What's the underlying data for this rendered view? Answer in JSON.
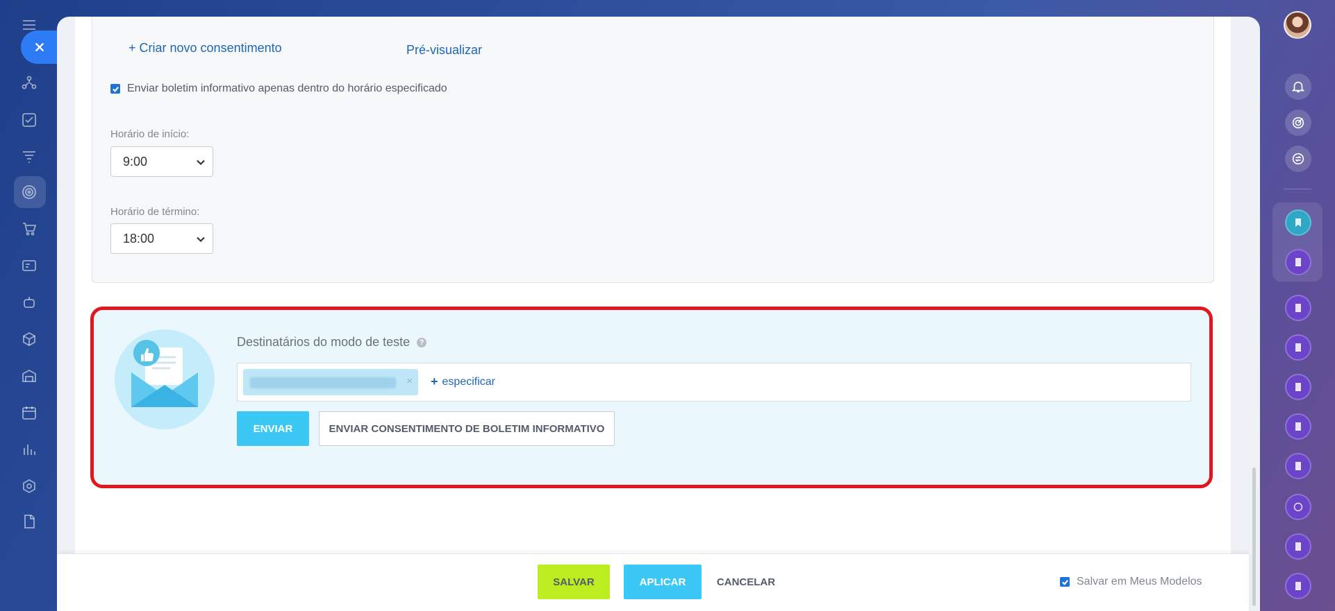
{
  "settings": {
    "create_consent_link": "+ Criar novo consentimento",
    "preview_link": "Pré-visualizar",
    "time_restriction_checkbox_label": "Enviar boletim informativo apenas dentro do horário especificado",
    "time_restriction_checked": true,
    "start_time_label": "Horário de início:",
    "start_time_value": "9:00",
    "end_time_label": "Horário de término:",
    "end_time_value": "18:00"
  },
  "test_mode": {
    "title": "Destinatários do modo de teste",
    "help_icon": "?",
    "recipient_tag_remove": "×",
    "specify_link_plus": "+",
    "specify_link": "especificar",
    "send_button": "ENVIAR",
    "send_consent_button": "ENVIAR CONSENTIMENTO DE BOLETIM INFORMATIVO"
  },
  "footer": {
    "save_button": "SALVAR",
    "apply_button": "APLICAR",
    "cancel_button": "CANCELAR",
    "save_template_label": "Salvar em Meus Modelos",
    "save_template_checked": true
  },
  "left_sidebar": {
    "icons": [
      "menu-icon",
      "close-icon",
      "network-icon",
      "task-check-icon",
      "funnel-icon",
      "target-icon",
      "cart-icon",
      "id-card-icon",
      "robot-icon",
      "cube-icon",
      "warehouse-icon",
      "calendar-icon",
      "bar-chart-icon",
      "hexagon-icon",
      "document-icon"
    ]
  },
  "right_sidebar": {
    "icons": [
      "user-avatar",
      "bell-icon",
      "target-icon",
      "chat-refresh-icon",
      "bookmark-icon",
      "document-icon"
    ]
  },
  "colors": {
    "accent_blue": "#3bc8f5",
    "save_green": "#bbed21",
    "highlight_red": "#e0181e",
    "link_blue": "#2067b0",
    "close_blue": "#2e7bf6"
  }
}
